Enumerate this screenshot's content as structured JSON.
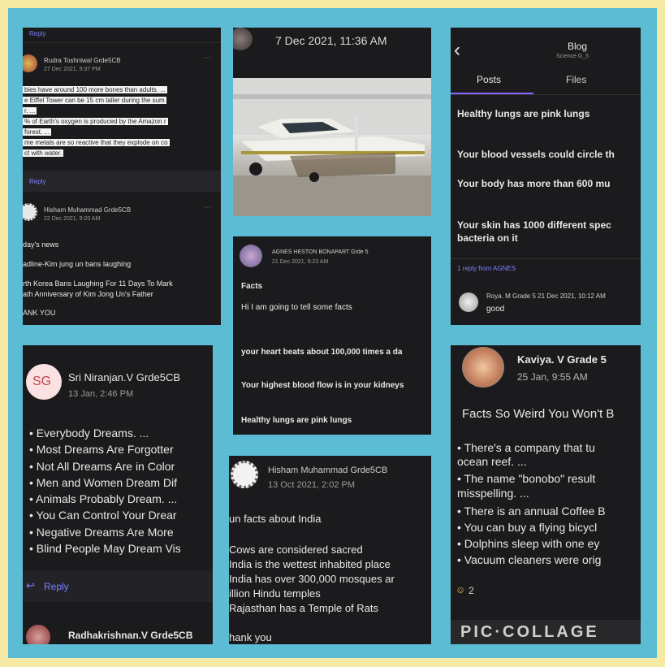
{
  "tile1": {
    "reply_top": "Reply",
    "author": "Rudra Toshniwal Grde5CB",
    "date": "27 Dec 2021, 9:37 PM",
    "lines": [
      "bies have around 100 more bones than adults. ...",
      "e Eiffel Tower can be 15 cm taller during the sum",
      "r. ...",
      "% of Earth's oxygen is produced by the Amazon r",
      "forest. ...",
      "me metals are so reactive that they explode on co",
      "ct with water."
    ],
    "reply_mid": "Reply",
    "author2": "Hisham Muhammad Grde5CB",
    "date2": "22 Dec 2021, 9:20 AM",
    "lines2": [
      "day's news",
      "adline-Kim jung un bans laughing",
      "rth Korea Bans Laughing For 11 Days To Mark",
      "ath Anniversary of Kim Jong Un's Father",
      "ANK YOU"
    ]
  },
  "tile2": {
    "timestamp": "7 Dec 2021, 11:36 AM"
  },
  "tile3": {
    "back": "‹",
    "title": "Blog",
    "subtitle": "Science G_5",
    "tab_posts": "Posts",
    "tab_files": "Files",
    "facts": [
      "Healthy lungs are pink lungs",
      "Your blood vessels could circle th",
      "Your body has more than 600 mu",
      "Your skin has 1000 different spec",
      "bacteria on it"
    ],
    "reply_from": "1 reply from AGNES",
    "reply_author": "Roya. M Grade 5 21 Dec 2021, 10:12 AM",
    "reply_text": "good"
  },
  "tile4": {
    "author": "AGNES HESTON BONAPART Grde 5",
    "date": "21 Dec 2021, 9:23 AM",
    "heading": "Facts",
    "intro": "Hi I am going to tell some facts",
    "facts": [
      "your heart beats about 100,000 times a da",
      "Your highest blood flow is in your kidneys",
      "Healthy lungs are pink lungs"
    ]
  },
  "tile5": {
    "initials": "SG",
    "author": "Sri Niranjan.V Grde5CB",
    "date": "13 Jan, 2:46 PM",
    "items": [
      "• Everybody Dreams. ...",
      "• Most Dreams Are Forgotter",
      "• Not All Dreams Are in Color",
      "• Men and Women Dream Dif",
      "• Animals Probably Dream. ...",
      "• You Can Control Your Drear",
      "• Negative Dreams Are More",
      "• Blind People May Dream Vis"
    ],
    "reply": "Reply",
    "next_author": "Radhakrishnan.V Grde5CB"
  },
  "tile6": {
    "author": "Hisham Muhammad Grde5CB",
    "date": "13 Oct 2021, 2:02 PM",
    "lines": [
      "un facts about India",
      "Cows are considered sacred",
      "India is the wettest inhabited place",
      "India has over 300,000 mosques ar",
      "illion Hindu temples",
      "Rajasthan has a Temple of Rats",
      "hank you"
    ]
  },
  "tile7": {
    "author": "Kaviya. V Grade 5",
    "date": "25 Jan, 9:55 AM",
    "title": "Facts So Weird You Won't B",
    "items": [
      "• There's a company that tu",
      "ocean reef. ...",
      "• The name \"bonobo\" result",
      "misspelling. ...",
      "• There is an annual Coffee B",
      "• You can buy a flying bicycl",
      "• Dolphins sleep with one ey",
      "• Vacuum cleaners were orig"
    ],
    "reaction_count": "2",
    "watermark": "PIC·COLLAGE"
  }
}
